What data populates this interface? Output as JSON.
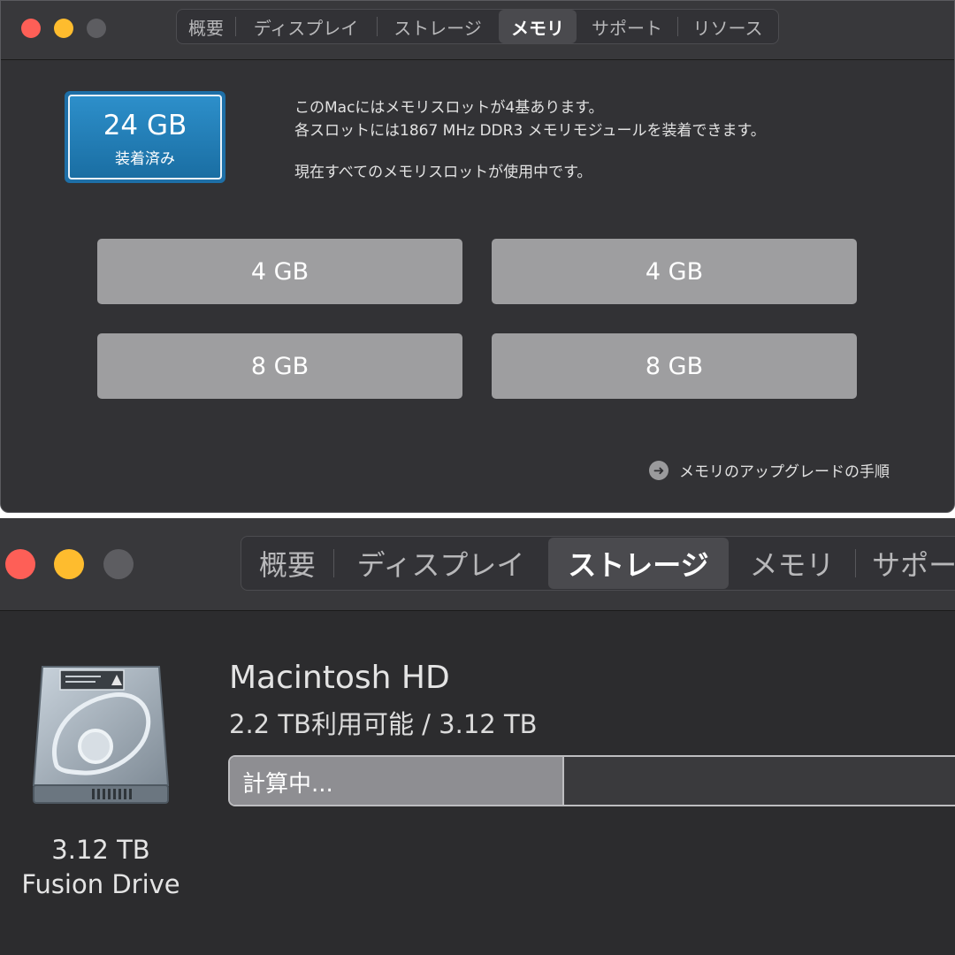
{
  "memory_window": {
    "tabs": [
      {
        "label": "概要",
        "active": false
      },
      {
        "label": "ディスプレイ",
        "active": false
      },
      {
        "label": "ストレージ",
        "active": false
      },
      {
        "label": "メモリ",
        "active": true
      },
      {
        "label": "サポート",
        "active": false
      },
      {
        "label": "リソース",
        "active": false
      }
    ],
    "badge": {
      "size": "24 GB",
      "status": "装着済み"
    },
    "info_lines": [
      "このMacにはメモリスロットが4基あります。",
      "各スロットには1867 MHz DDR3 メモリモジュールを装着できます。",
      "現在すべてのメモリスロットが使用中です。"
    ],
    "slots": [
      "4 GB",
      "4 GB",
      "8 GB",
      "8 GB"
    ],
    "upgrade_link": "メモリのアップグレードの手順"
  },
  "storage_window": {
    "tabs": [
      {
        "label": "概要",
        "active": false
      },
      {
        "label": "ディスプレイ",
        "active": false
      },
      {
        "label": "ストレージ",
        "active": true
      },
      {
        "label": "メモリ",
        "active": false
      },
      {
        "label": "サポー",
        "active": false
      }
    ],
    "volume_name": "Macintosh HD",
    "space_text": "2.2 TB利用可能 / 3.12 TB",
    "progress_text": "計算中...",
    "drive_capacity": "3.12 TB",
    "drive_type": "Fusion Drive"
  },
  "colors": {
    "badge_blue": "#1e6fa7",
    "slot_gray": "#9e9ea0",
    "close": "#fe5f57",
    "minimize": "#febc2e",
    "zoom_disabled": "#5d5d61"
  },
  "icons": [
    "close-icon",
    "minimize-icon",
    "zoom-icon",
    "arrow-right-circle-icon",
    "hard-drive-icon"
  ]
}
